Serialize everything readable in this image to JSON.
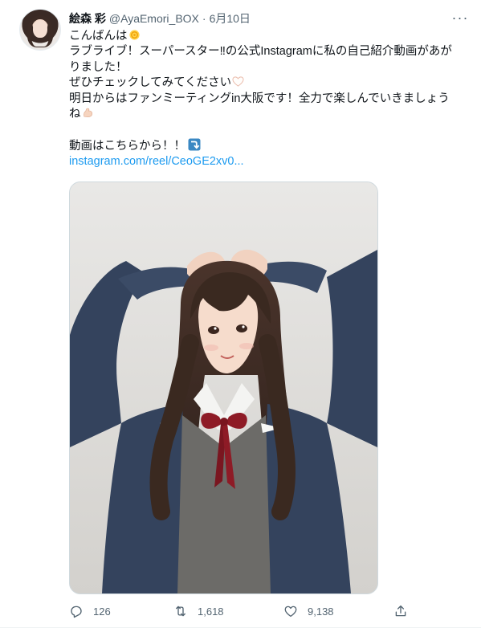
{
  "tweet": {
    "display_name": "絵森 彩",
    "handle": "@AyaEmori_BOX",
    "separator": "·",
    "date": "6月10日",
    "more_label": "···",
    "lines": [
      "こんばんは",
      "ラブライブ！スーパースター‼︎の公式Instagramに私の自己紹介動画があが",
      "りました！",
      "ぜひチェックしてみてください",
      "明日からはファンミーティングin大阪です！全力で楽しんでいきましょう",
      "ね",
      "",
      "動画はこちらから！！"
    ],
    "link": "instagram.com/reel/CeoGE2xv0...",
    "emojis": [
      "dizzy-emoji",
      "white-heart-emoji",
      "flexed-biceps-emoji",
      "right-arrow-curving-down-emoji"
    ]
  },
  "actions": {
    "reply_count": "126",
    "retweet_count": "1,618",
    "like_count": "9,138"
  },
  "colors": {
    "link": "#1d9bf0",
    "secondary_text": "#536471",
    "primary_text": "#0f1419",
    "media_border": "#cfd9de",
    "jacket": "#34435d",
    "ribbon": "#8e1b26",
    "vest": "#6c6b68"
  }
}
